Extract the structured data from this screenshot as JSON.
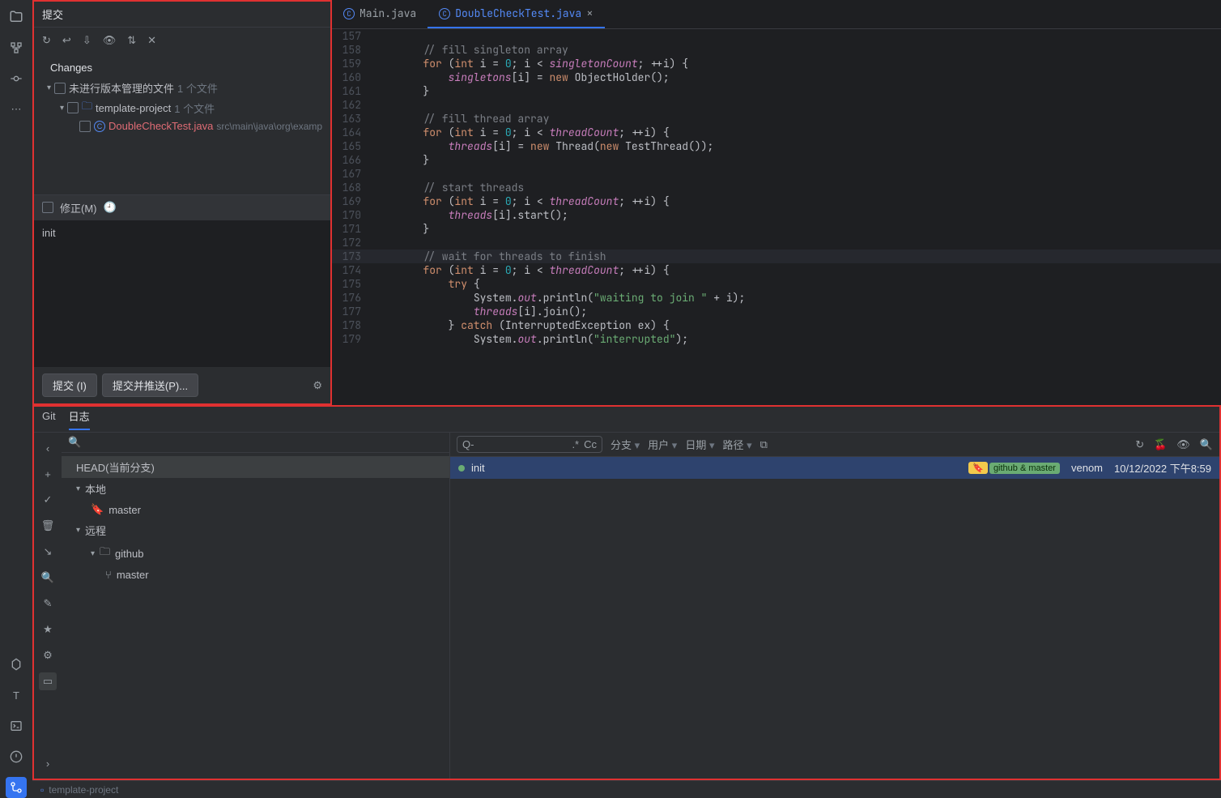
{
  "leftRail": {
    "icons": [
      "project",
      "structure",
      "commit",
      "more",
      "services",
      "terminal",
      "run",
      "problems",
      "git"
    ]
  },
  "commitPanel": {
    "title": "提交",
    "changesLabel": "Changes",
    "unversioned": {
      "label": "未进行版本管理的文件",
      "count": "1 个文件"
    },
    "projectFolder": {
      "name": "template-project",
      "count": "1 个文件"
    },
    "file": {
      "name": "DoubleCheckTest.java",
      "path": "src\\main\\java\\org\\examp"
    },
    "amend": {
      "label": "修正(M)"
    },
    "message": "init",
    "buttons": {
      "commit": "提交 (I)",
      "commitPush": "提交并推送(P)..."
    }
  },
  "editor": {
    "tabs": [
      {
        "name": "Main.java",
        "active": false
      },
      {
        "name": "DoubleCheckTest.java",
        "active": true
      }
    ],
    "startLine": 157,
    "activeLine": 173,
    "code": [
      "",
      "        // fill singleton array",
      "        for (int i = 0; i < singletonCount; ++i) {",
      "            singletons[i] = new ObjectHolder();",
      "        }",
      "",
      "        // fill thread array",
      "        for (int i = 0; i < threadCount; ++i) {",
      "            threads[i] = new Thread(new TestThread());",
      "        }",
      "",
      "        // start threads",
      "        for (int i = 0; i < threadCount; ++i) {",
      "            threads[i].start();",
      "        }",
      "",
      "        // wait for threads to finish",
      "        for (int i = 0; i < threadCount; ++i) {",
      "            try {",
      "                System.out.println(\"waiting to join \" + i);",
      "                threads[i].join();",
      "            } catch (InterruptedException ex) {",
      "                System.out.println(\"interrupted\");"
    ]
  },
  "git": {
    "tabs": {
      "git": "Git",
      "log": "日志"
    },
    "head": "HEAD(当前分支)",
    "localLabel": "本地",
    "localBranch": "master",
    "remoteLabel": "远程",
    "remoteName": "github",
    "remoteBranch": "master",
    "filters": {
      "branch": "分支",
      "user": "用户",
      "date": "日期",
      "path": "路径"
    },
    "searchPrefix": "Q-",
    "regex": ".*",
    "cc": "Cc",
    "commit": {
      "msg": "init",
      "tags": "github & master",
      "author": "venom",
      "date": "10/12/2022 下午8:59"
    }
  },
  "status": {
    "project": "template-project"
  }
}
